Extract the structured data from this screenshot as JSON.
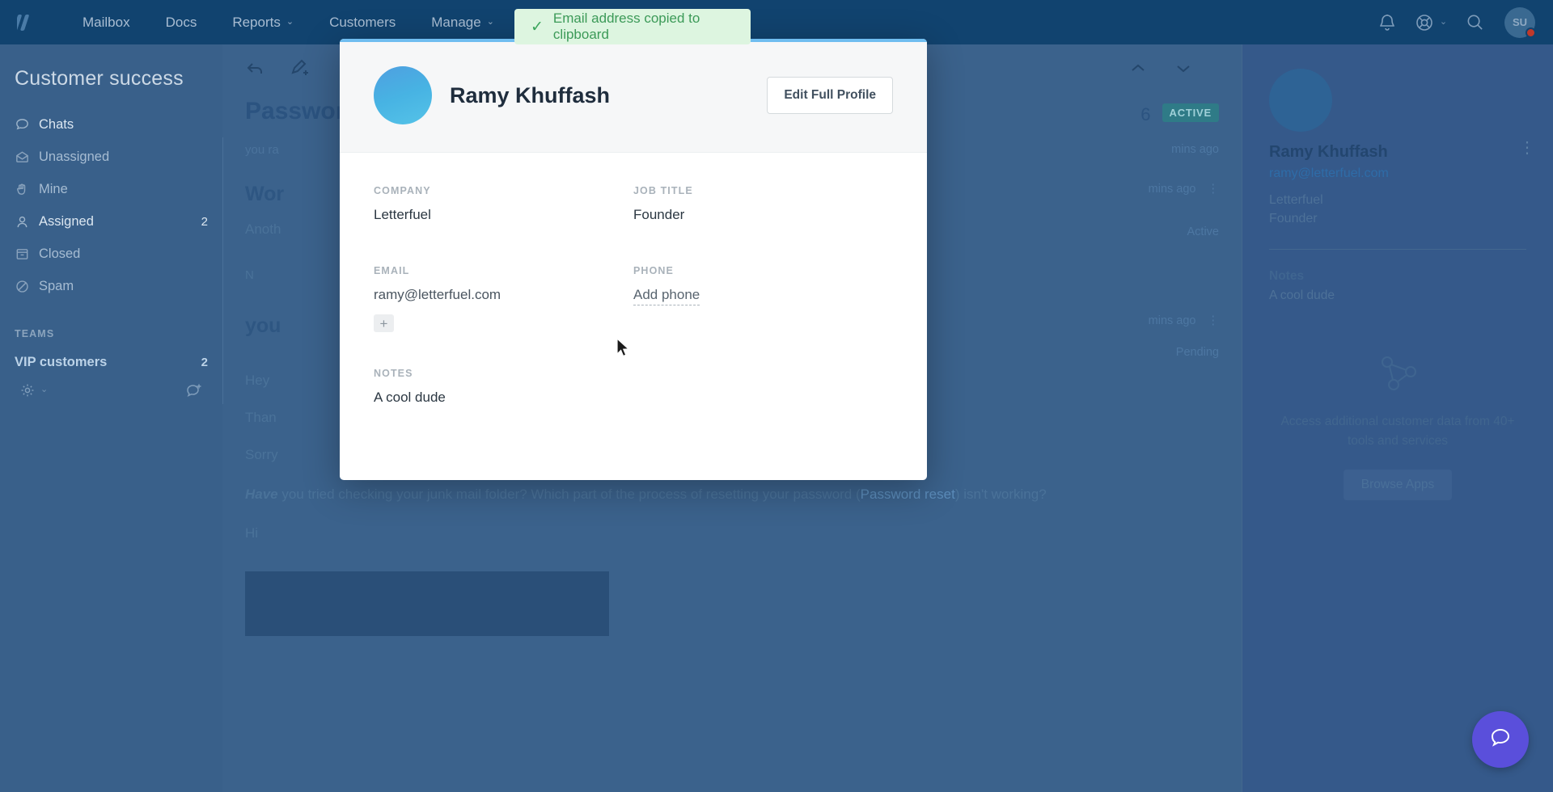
{
  "topbar": {
    "logo_icon": "helpscout-logo-icon",
    "nav": [
      {
        "label": "Mailbox",
        "caret": ""
      },
      {
        "label": "Docs",
        "caret": ""
      },
      {
        "label": "Reports",
        "caret": "⌄"
      },
      {
        "label": "Customers",
        "caret": ""
      },
      {
        "label": "Manage",
        "caret": "⌄"
      }
    ],
    "icons": [
      "bell-icon",
      "lifebuoy-icon",
      "search-icon"
    ],
    "lifebuoy_caret": "⌄",
    "avatar_initials": "SU"
  },
  "toast": {
    "icon": "check-icon",
    "check": "✓",
    "message": "Email address copied to clipboard",
    "bg_color": "#ddf5e0",
    "text_color": "#3c9a58"
  },
  "sidebar": {
    "title": "Customer success",
    "items": [
      {
        "label": "Chats",
        "icon": "chat-bubble-icon",
        "count": ""
      },
      {
        "label": "Unassigned",
        "icon": "open-envelope-icon",
        "count": ""
      },
      {
        "label": "Mine",
        "icon": "hand-icon",
        "count": ""
      },
      {
        "label": "Assigned",
        "icon": "person-icon",
        "count": "2"
      },
      {
        "label": "Closed",
        "icon": "archive-box-icon",
        "count": ""
      },
      {
        "label": "Spam",
        "icon": "no-entry-icon",
        "count": ""
      }
    ],
    "section_label": "TEAMS",
    "teams": [
      {
        "label": "VIP customers",
        "count": "2"
      }
    ],
    "footer_icons": [
      "gear-icon",
      "new-conversation-icon"
    ],
    "gear_caret": "⌄"
  },
  "conversation": {
    "toolbar_icons": [
      "back-arrow-icon",
      "edit-note-icon"
    ],
    "nav_up": "⌃",
    "nav_down": "⌄",
    "title": "Password",
    "id": "6",
    "status_badge": "ACTIVE",
    "meta_time": "mins ago",
    "messages": [
      {
        "title": "Wor",
        "time": "mins ago",
        "status": "Active",
        "body": "Anoth"
      },
      {
        "title": "you",
        "time": "mins ago",
        "status": "Pending",
        "body": ""
      }
    ],
    "snippets": [
      "you ra",
      "Hey",
      "Than",
      "Sorry",
      "Hi"
    ],
    "note_placeholder": "N",
    "paragraph_lead": "Have",
    "paragraph_rest": " you tried checking your junk mail folder? Which part of the process of resetting your password (",
    "paragraph_link": "Password reset",
    "paragraph_tail": ") isn't working?"
  },
  "right_panel": {
    "name": "Ramy Khuffash",
    "email": "ramy@letterfuel.com",
    "company": "Letterfuel",
    "job_title": "Founder",
    "kebab_icon": "kebab-menu-icon",
    "notes_label": "Notes",
    "notes_value": "A cool dude",
    "apps_icon": "network-nodes-icon",
    "apps_text": "Access additional customer data from 40+ tools and services",
    "apps_button": "Browse Apps"
  },
  "modal": {
    "accent_color": "#6fbdf0",
    "avatar_icon": "customer-avatar",
    "name": "Ramy Khuffash",
    "edit_button": "Edit Full Profile",
    "fields": {
      "company_label": "COMPANY",
      "company_value": "Letterfuel",
      "job_title_label": "JOB TITLE",
      "job_title_value": "Founder",
      "email_label": "EMAIL",
      "email_value": "ramy@letterfuel.com",
      "email_add": "+",
      "phone_label": "PHONE",
      "phone_add": "Add phone",
      "notes_label": "NOTES",
      "notes_value": "A cool dude"
    }
  },
  "help_bubble": {
    "icon": "chat-help-icon",
    "color": "#5a4fdb"
  }
}
